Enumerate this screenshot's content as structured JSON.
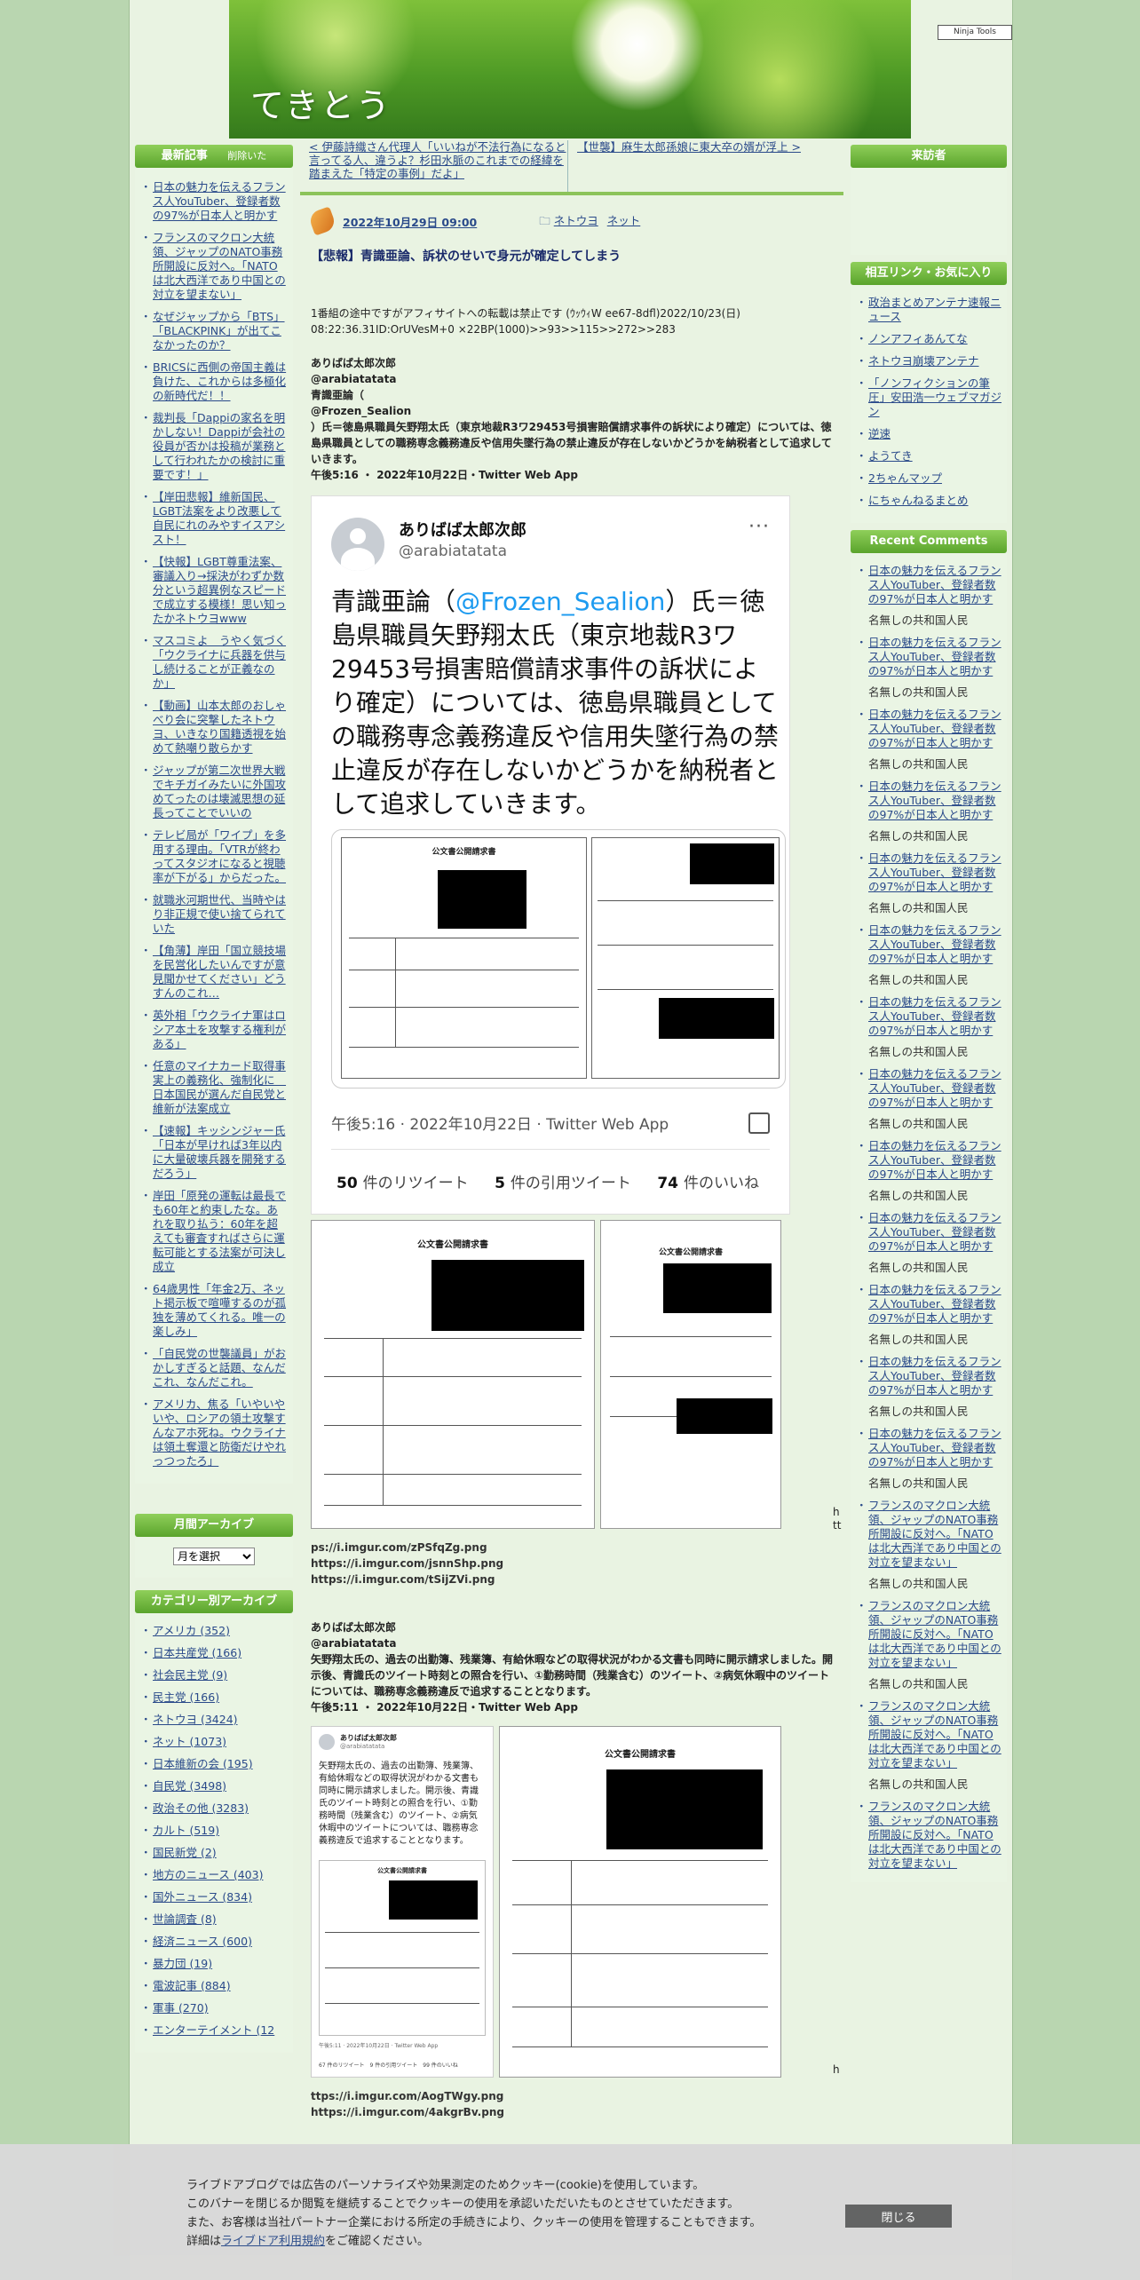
{
  "site": {
    "title": "てきとう",
    "subtitle": "",
    "ninja": "Ninja Tools"
  },
  "left": {
    "recent_title": "最新記事",
    "recent_aside": "削除いた",
    "recent_items": [
      "日本の魅力を伝えるフランス人YouTuber、登録者数の97%が日本人と明かす",
      "フランスのマクロン大統領、ジャップのNATO事務所開設に反対へ。「NATOは北大西洋であり中国との対立を望まない」",
      "なぜジャップから「BTS」「BLACKPINK」が出てこなかったのか？",
      "BRICSに西側の帝国主義は負けた、これからは多極化の新時代だ！！",
      "裁判長「Dappiの家名を明かしない！Dappiが会社の役員が否かは投稿が業務として行われたかの検討に重要です！」",
      "【岸田悲報】維新国民、LGBT法案をより改悪して自民にれのみやすイスアシスト！",
      "【快報】LGBT尊重法案、審議入り→採決がわずか数分という超異例なスピードで成立する模様！思い知ったかネトウヨwww",
      "マスコミよ　うやく気づく「ウクライナに兵器を供与し続けることが正義なのか」",
      "【動画】山本太郎のおしゃべり会に突撃したネトウヨ、いきなり国籍透視を始めて熱嘲り散らかす",
      "ジャップが第二次世界大戦でキチガイみたいに外国攻めてったのは壊滅思想の延長ってことでいいの",
      "テレビ局が「ワイプ」を多用する理由。「VTRが終わってスタジオになると視聴率が下がる」からだった。",
      "就職氷河期世代、当時やはり非正規で使い捨てられていた",
      "【角薄】岸田「国立競技場を民営化したいんですが意見聞かせてください」どうすんのこれ…",
      "英外相「ウクライナ軍はロシア本土を攻撃する権利がある」",
      "任意のマイナカード取得事実上の義務化、強制化に　日本国民が選んだ自民党と維新が法案成立",
      "【速報】キッシンジャー氏「日本が早ければ3年以内に大量破壊兵器を開発するだろう」",
      "岸田「原発の運転は最長でも60年と約束したな。あれを取り払う：60年を超えても審査すればさらに運転可能とする法案が可決し成立",
      "64歳男性「年金2万、ネット掲示板で喧嘩するのが孤独を薄めてくれる。唯一の楽しみ」",
      "「自民党の世襲議員」がおかしすぎると話題、なんだこれ、なんだこれ。",
      "アメリカ、焦る「いやいやいや、ロシアの領土攻撃すんなアホ死ね。ウクライナは領土奪還と防衛だけやれっつったろ」"
    ],
    "archive_title": "月間アーカイブ",
    "archive_select": "月を選択",
    "category_title": "カテゴリー別アーカイブ",
    "categories": [
      "アメリカ (352)",
      "日本共産党 (166)",
      "社会民主党 (9)",
      "民主党 (166)",
      "ネトウヨ (3424)",
      "ネット (1073)",
      "日本維新の会 (195)",
      "自民党 (3498)",
      "政治その他 (3283)",
      "カルト (519)",
      "国民新党 (2)",
      "地方のニュース (403)",
      "国外ニュース (834)",
      "世論調査 (8)",
      "経済ニュース (600)",
      "暴力団 (19)",
      "電波記事 (884)",
      "軍事 (270)",
      "エンターテイメント (12"
    ]
  },
  "right": {
    "visitors_title": "来訪者",
    "links_title": "相互リンク・お気に入り",
    "links": [
      "政治まとめアンテナ速報ニュース",
      "ノンアフィあんてな",
      "ネトウヨ崩壊アンテナ",
      "「ノンフィクションの筆圧」安田浩一ウェブマガジン",
      "逆速",
      "ようてき",
      "2ちゃんマップ",
      "にちゃんねるまとめ"
    ],
    "recent_comments_title": "Recent Comments",
    "comments": [
      {
        "post": "日本の魅力を伝えるフランス人YouTuber、登録者数の97%が日本人と明かす",
        "author": "名無しの共和国人民"
      },
      {
        "post": "日本の魅力を伝えるフランス人YouTuber、登録者数の97%が日本人と明かす",
        "author": "名無しの共和国人民"
      },
      {
        "post": "日本の魅力を伝えるフランス人YouTuber、登録者数の97%が日本人と明かす",
        "author": "名無しの共和国人民"
      },
      {
        "post": "日本の魅力を伝えるフランス人YouTuber、登録者数の97%が日本人と明かす",
        "author": "名無しの共和国人民"
      },
      {
        "post": "日本の魅力を伝えるフランス人YouTuber、登録者数の97%が日本人と明かす",
        "author": "名無しの共和国人民"
      },
      {
        "post": "日本の魅力を伝えるフランス人YouTuber、登録者数の97%が日本人と明かす",
        "author": "名無しの共和国人民"
      },
      {
        "post": "日本の魅力を伝えるフランス人YouTuber、登録者数の97%が日本人と明かす",
        "author": "名無しの共和国人民"
      },
      {
        "post": "日本の魅力を伝えるフランス人YouTuber、登録者数の97%が日本人と明かす",
        "author": "名無しの共和国人民"
      },
      {
        "post": "日本の魅力を伝えるフランス人YouTuber、登録者数の97%が日本人と明かす",
        "author": "名無しの共和国人民"
      },
      {
        "post": "日本の魅力を伝えるフランス人YouTuber、登録者数の97%が日本人と明かす",
        "author": "名無しの共和国人民"
      },
      {
        "post": "日本の魅力を伝えるフランス人YouTuber、登録者数の97%が日本人と明かす",
        "author": "名無しの共和国人民"
      },
      {
        "post": "日本の魅力を伝えるフランス人YouTuber、登録者数の97%が日本人と明かす",
        "author": "名無しの共和国人民"
      },
      {
        "post": "日本の魅力を伝えるフランス人YouTuber、登録者数の97%が日本人と明かす",
        "author": "名無しの共和国人民"
      },
      {
        "post": "フランスのマクロン大統領、ジャップのNATO事務所開設に反対へ。「NATOは北大西洋であり中国との対立を望まない」",
        "author": "名無しの共和国人民"
      },
      {
        "post": "フランスのマクロン大統領、ジャップのNATO事務所開設に反対へ。「NATOは北大西洋であり中国との対立を望まない」",
        "author": "名無しの共和国人民"
      },
      {
        "post": "フランスのマクロン大統領、ジャップのNATO事務所開設に反対へ。「NATOは北大西洋であり中国との対立を望まない」",
        "author": "名無しの共和国人民"
      },
      {
        "post": "フランスのマクロン大統領、ジャップのNATO事務所開設に反対へ。「NATOは北大西洋であり中国との対立を望まない」",
        "author": ""
      }
    ]
  },
  "post": {
    "prev_link": "< 伊藤詩織さん代理人「いいねが不法行為になると言ってる人、違うよ？杉田水脈のこれまでの経緯を踏まえた「特定の事例」だよ」",
    "next_link": "【世襲】麻生太郎孫娘に東大卒の婿が浮上 >",
    "date": "2022年10月29日 09:00",
    "cat1": "ネトウヨ",
    "cat2": "ネット",
    "title": "【悲報】青識亜論、訴状のせいで身元が確定してしまう",
    "intro": "1番組の途中ですがアフィサイトへの転載は禁止です (ｳｯｳｨW ee67-8dfl)2022/10/23(日) 08:22:36.31ID:OrUVesM+0 ×22BP(1000)>>93>>115>>272>>283",
    "q1_name": "ありばば太郎次郎",
    "q1_handle": "@arabiatatata",
    "q1_line1": "青識亜論（",
    "q1_line2": "@Frozen_Sealion",
    "q1_line3": "）氏＝徳島県職員矢野翔太氏（東京地裁R3ワ29453号損害賠償請求事件の訴状により確定）については、徳島県職員としての職務専念義務違反や信用失墜行為の禁止違反が存在しないかどうかを納税者として追求していきます。",
    "q1_time": "午後5:16 ・ 2022年10月22日・Twitter Web App",
    "tweet": {
      "name": "ありばば太郎次郎",
      "handle": "@arabiatatata",
      "more": "···",
      "body_pre": "青識亜論（",
      "body_mention": "@Frozen_Sealion",
      "body_post": "）氏＝徳島県職員矢野翔太氏（東京地裁R3ワ29453号損害賠償請求事件の訴状により確定）については、徳島県職員としての職務専念義務違反や信用失墜行為の禁止違反が存在しないかどうかを納税者として追求していきます。",
      "time": "午後5:16 · 2022年10月22日 · Twitter Web App",
      "rt_count": "50",
      "rt_label": "件のリツイート",
      "qt_count": "5",
      "qt_label": "件の引用ツイート",
      "like_count": "74",
      "like_label": "件のいいね"
    },
    "doc_title": "公文書公開請求書",
    "side_h": "h",
    "side_tt": "tt",
    "links1": [
      "ps://i.imgur.com/zPSfqZg.png",
      "https://i.imgur.com/jsnnShp.png",
      "https://i.imgur.com/tSijZVi.png"
    ],
    "q2_name": "ありばば太郎次郎",
    "q2_handle": "@arabiatatata",
    "q2_text": "矢野翔太氏の、過去の出勤簿、残業簿、有給休暇などの取得状況がわかる文書も同時に開示請求しました。開示後、青識氏のツイート時刻との照合を行い、①勤務時間（残業含む）のツイート、②病気休暇中のツイートについては、職務専念義務違反で追求することとなります。",
    "q2_time": "午後5:11 ・ 2022年10月22日・Twitter Web App",
    "mini_tweet_name": "ありばば太郎次郎",
    "mini_tweet_handle": "@arabiatatata",
    "mini_tweet_body": "矢野翔太氏の、過去の出勤簿、残業簿、有給休暇などの取得状況がわかる文書も同時に開示請求しました。開示後、青識氏のツイート時刻との照合を行い、①勤務時間（残業含む）のツイート、②病気休暇中のツイートについては、職務専念義務違反で追求することとなります。",
    "mini_tweet_time": "午後5:11 · 2022年10月22日 · Twitter Web App",
    "mini_tweet_stats": "67 件のリツイート　9 件の引用ツイート　99 件のいいね",
    "side_h2": "h",
    "links2": [
      "ttps://i.imgur.com/AogTWgy.png",
      "https://i.imgur.com/4akgrBv.png"
    ]
  },
  "cookie": {
    "line1": "ライブドアブログでは広告のパーソナライズや効果測定のためクッキー(cookie)を使用しています。",
    "line2": "このバナーを閉じるか閲覧を継続することでクッキーの使用を承認いただいたものとさせていただきます。",
    "line3": "また、お客様は当社パートナー企業における所定の手続きにより、クッキーの使用を管理することもできます。",
    "line4_pre": "詳細は",
    "line4_link": "ライブドア利用規約",
    "line4_post": "をご確認ください。",
    "close": "閉じる"
  }
}
